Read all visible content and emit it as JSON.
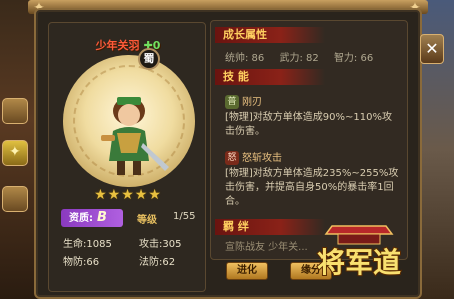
{
  "hero": {
    "name": "少年关羽",
    "level_tag": "✚0",
    "faction": "蜀",
    "stars": "★★★★★",
    "quality_label": "资质:",
    "quality_grade": "B",
    "grade_label": "等级",
    "grade_value": "1/55",
    "stats": {
      "hp": "生命:1085",
      "attack": "攻击:305",
      "phys_def": "物防:66",
      "magic_def": "法防:62"
    }
  },
  "info": {
    "growth_title": "成长属性",
    "growth": {
      "command": "统帅: 86",
      "force": "武力: 82",
      "intellect": "智力: 66"
    },
    "skills_title": "技 能",
    "skills": [
      {
        "icon": "普",
        "name": "刚刃",
        "desc": "[物理]对敌方单体造成90%~110%攻击伤害。"
      },
      {
        "icon": "怒",
        "name": "怒斩攻击",
        "desc": "[物理]对敌方单体造成235%~255%攻击伤害，并提高自身50%的暴击率1回合。"
      }
    ],
    "fate_title": "羁 绊",
    "fate_partial": "宣陈战友 少年关..."
  },
  "buttons": {
    "close": "✕",
    "evolve": "进化",
    "fate": "缘分"
  },
  "logo_text": "将军道",
  "colors": {
    "name_red": "#ff5a3a",
    "quality_purple": "#9a48d0",
    "section_red": "#8a2218",
    "gold": "#ffd060"
  }
}
